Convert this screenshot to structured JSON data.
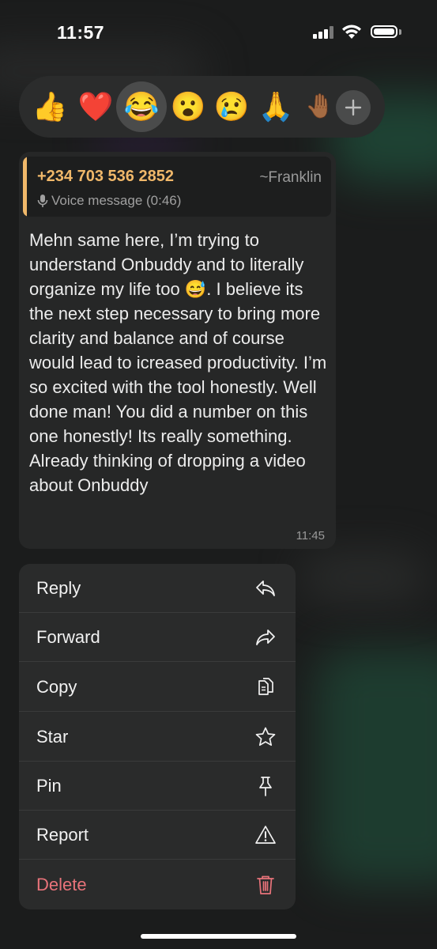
{
  "status_bar": {
    "time": "11:57"
  },
  "reactions": {
    "items": [
      {
        "name": "thumbs-up",
        "glyph": "👍"
      },
      {
        "name": "red-heart",
        "glyph": "❤️"
      },
      {
        "name": "tears-of-joy",
        "glyph": "😂",
        "selected": true
      },
      {
        "name": "face-open-mouth",
        "glyph": "😮"
      },
      {
        "name": "crying-face",
        "glyph": "😢"
      },
      {
        "name": "folded-hands",
        "glyph": "🙏"
      },
      {
        "name": "raised-hand",
        "glyph": "🤚🏾"
      }
    ],
    "more_icon": "plus-icon"
  },
  "message": {
    "quote": {
      "phone": "+234 703 536 2852",
      "author": "~Franklin",
      "subtitle": "Voice message (0:46)"
    },
    "text": "Mehn same here, I’m trying to understand Onbuddy and to literally organize my life too 😅. I believe its the next step necessary to bring more clarity and balance and of course would lead to icreased productivity. I’m so excited with the tool honestly. Well done man! You did a number on this one honestly! Its really something. Already thinking of dropping a video about Onbuddy",
    "time": "11:45"
  },
  "menu": {
    "items": [
      {
        "label": "Reply",
        "icon": "reply-icon"
      },
      {
        "label": "Forward",
        "icon": "forward-icon"
      },
      {
        "label": "Copy",
        "icon": "copy-icon"
      },
      {
        "label": "Star",
        "icon": "star-icon"
      },
      {
        "label": "Pin",
        "icon": "pin-icon"
      },
      {
        "label": "Report",
        "icon": "warning-icon"
      },
      {
        "label": "Delete",
        "icon": "trash-icon",
        "destructive": true
      }
    ]
  },
  "colors": {
    "accent_quote": "#f0b86a",
    "destructive": "#e8737a",
    "menu_bg": "#2a2b2b",
    "bubble_bg": "#262727"
  }
}
